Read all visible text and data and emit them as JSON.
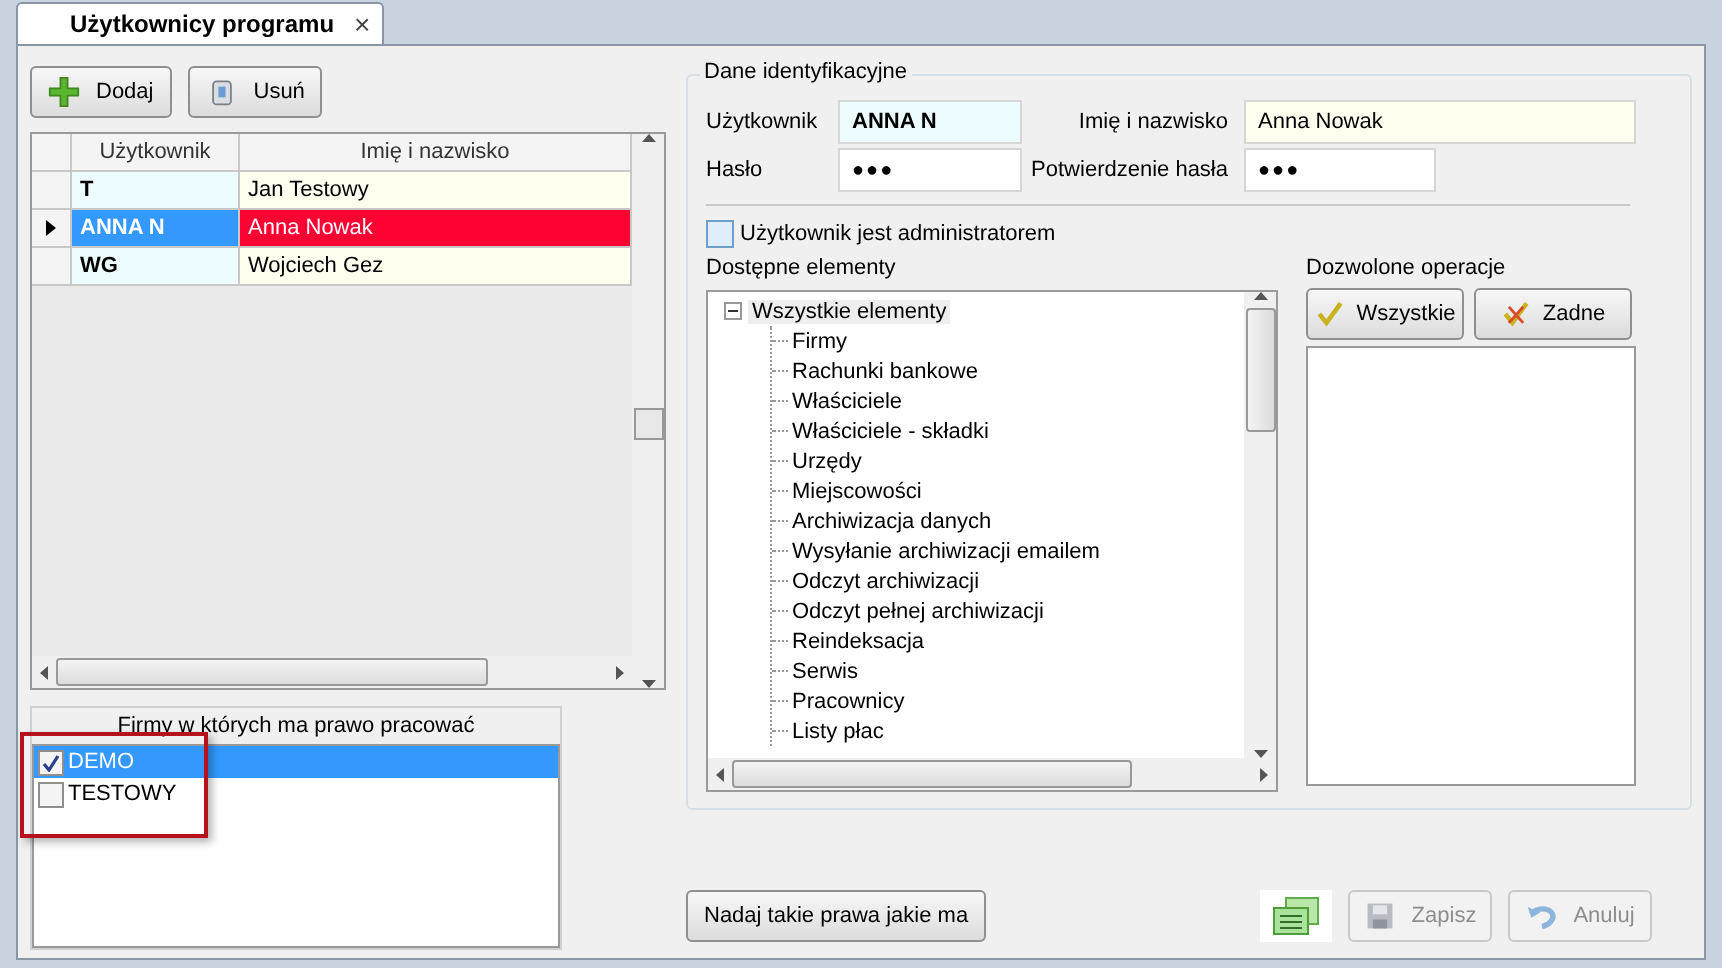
{
  "tab": {
    "title": "Użytkownicy programu",
    "close": "×"
  },
  "toolbar": [
    {
      "label": "Dodaj",
      "kind": "add"
    },
    {
      "label": "Usuń",
      "kind": "delete"
    }
  ],
  "users_table": {
    "columns": [
      "Użytkownik",
      "Imię i nazwisko"
    ],
    "rows": [
      {
        "user": "T",
        "name": "Jan Testowy",
        "selected": false
      },
      {
        "user": "ANNA N",
        "name": "Anna Nowak",
        "selected": true
      },
      {
        "user": "WG",
        "name": "Wojciech Gez",
        "selected": false
      }
    ]
  },
  "companies": {
    "title": "Firmy w których ma prawo pracować",
    "items": [
      {
        "label": "DEMO",
        "checked": true,
        "selected": true
      },
      {
        "label": "TESTOWY",
        "checked": false,
        "selected": false
      }
    ]
  },
  "identity": {
    "title": "Dane identyfikacyjne",
    "fields": [
      {
        "label": "Użytkownik",
        "value": "ANNA N",
        "kind": "login"
      },
      {
        "label": "Imię i nazwisko",
        "value": "Anna Nowak",
        "kind": "name"
      },
      {
        "label": "Hasło",
        "value": "●●●",
        "kind": "password"
      },
      {
        "label": "Potwierdzenie hasła",
        "value": "●●●",
        "kind": "password"
      }
    ],
    "admin": {
      "label": "Użytkownik jest administratorem",
      "checked": false
    },
    "elements": {
      "title": "Dostępne elementy",
      "tree": [
        {
          "label": "Wszystkie elementy",
          "expanded": true,
          "children": [
            {
              "label": "Firmy"
            },
            {
              "label": "Rachunki bankowe"
            },
            {
              "label": "Właściciele"
            },
            {
              "label": "Właściciele - składki"
            },
            {
              "label": "Urzędy"
            },
            {
              "label": "Miejscowości"
            },
            {
              "label": "Archiwizacja danych"
            },
            {
              "label": "Wysyłanie archiwizacji emailem"
            },
            {
              "label": "Odczyt archiwizacji"
            },
            {
              "label": "Odczyt pełnej archiwizacji"
            },
            {
              "label": "Reindeksacja"
            },
            {
              "label": "Serwis"
            },
            {
              "label": "Pracownicy"
            },
            {
              "label": "Listy płac"
            }
          ]
        }
      ]
    },
    "operations": {
      "title": "Dozwolone operacje",
      "buttons": [
        {
          "label": "Wszystkie",
          "kind": "all"
        },
        {
          "label": "Zadne",
          "kind": "none"
        }
      ]
    }
  },
  "footer": {
    "copy_button": "Nadaj takie prawa jakie ma",
    "actions": [
      {
        "kind": "list"
      },
      {
        "label": "Zapisz",
        "kind": "save",
        "disabled": true
      },
      {
        "label": "Anuluj",
        "kind": "cancel",
        "disabled": true
      }
    ]
  }
}
